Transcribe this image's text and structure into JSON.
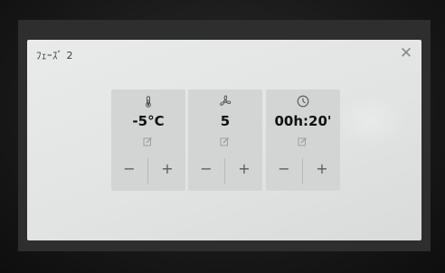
{
  "dialog": {
    "title": "ﾌｪｰｽﾞ 2",
    "close_label": "✕"
  },
  "cards": [
    {
      "icon": "thermometer-icon",
      "value": "-5°C",
      "minus": "−",
      "plus": "+"
    },
    {
      "icon": "fan-icon",
      "value": "5",
      "minus": "−",
      "plus": "+"
    },
    {
      "icon": "clock-icon",
      "value": "00h:20'",
      "minus": "−",
      "plus": "+"
    }
  ]
}
